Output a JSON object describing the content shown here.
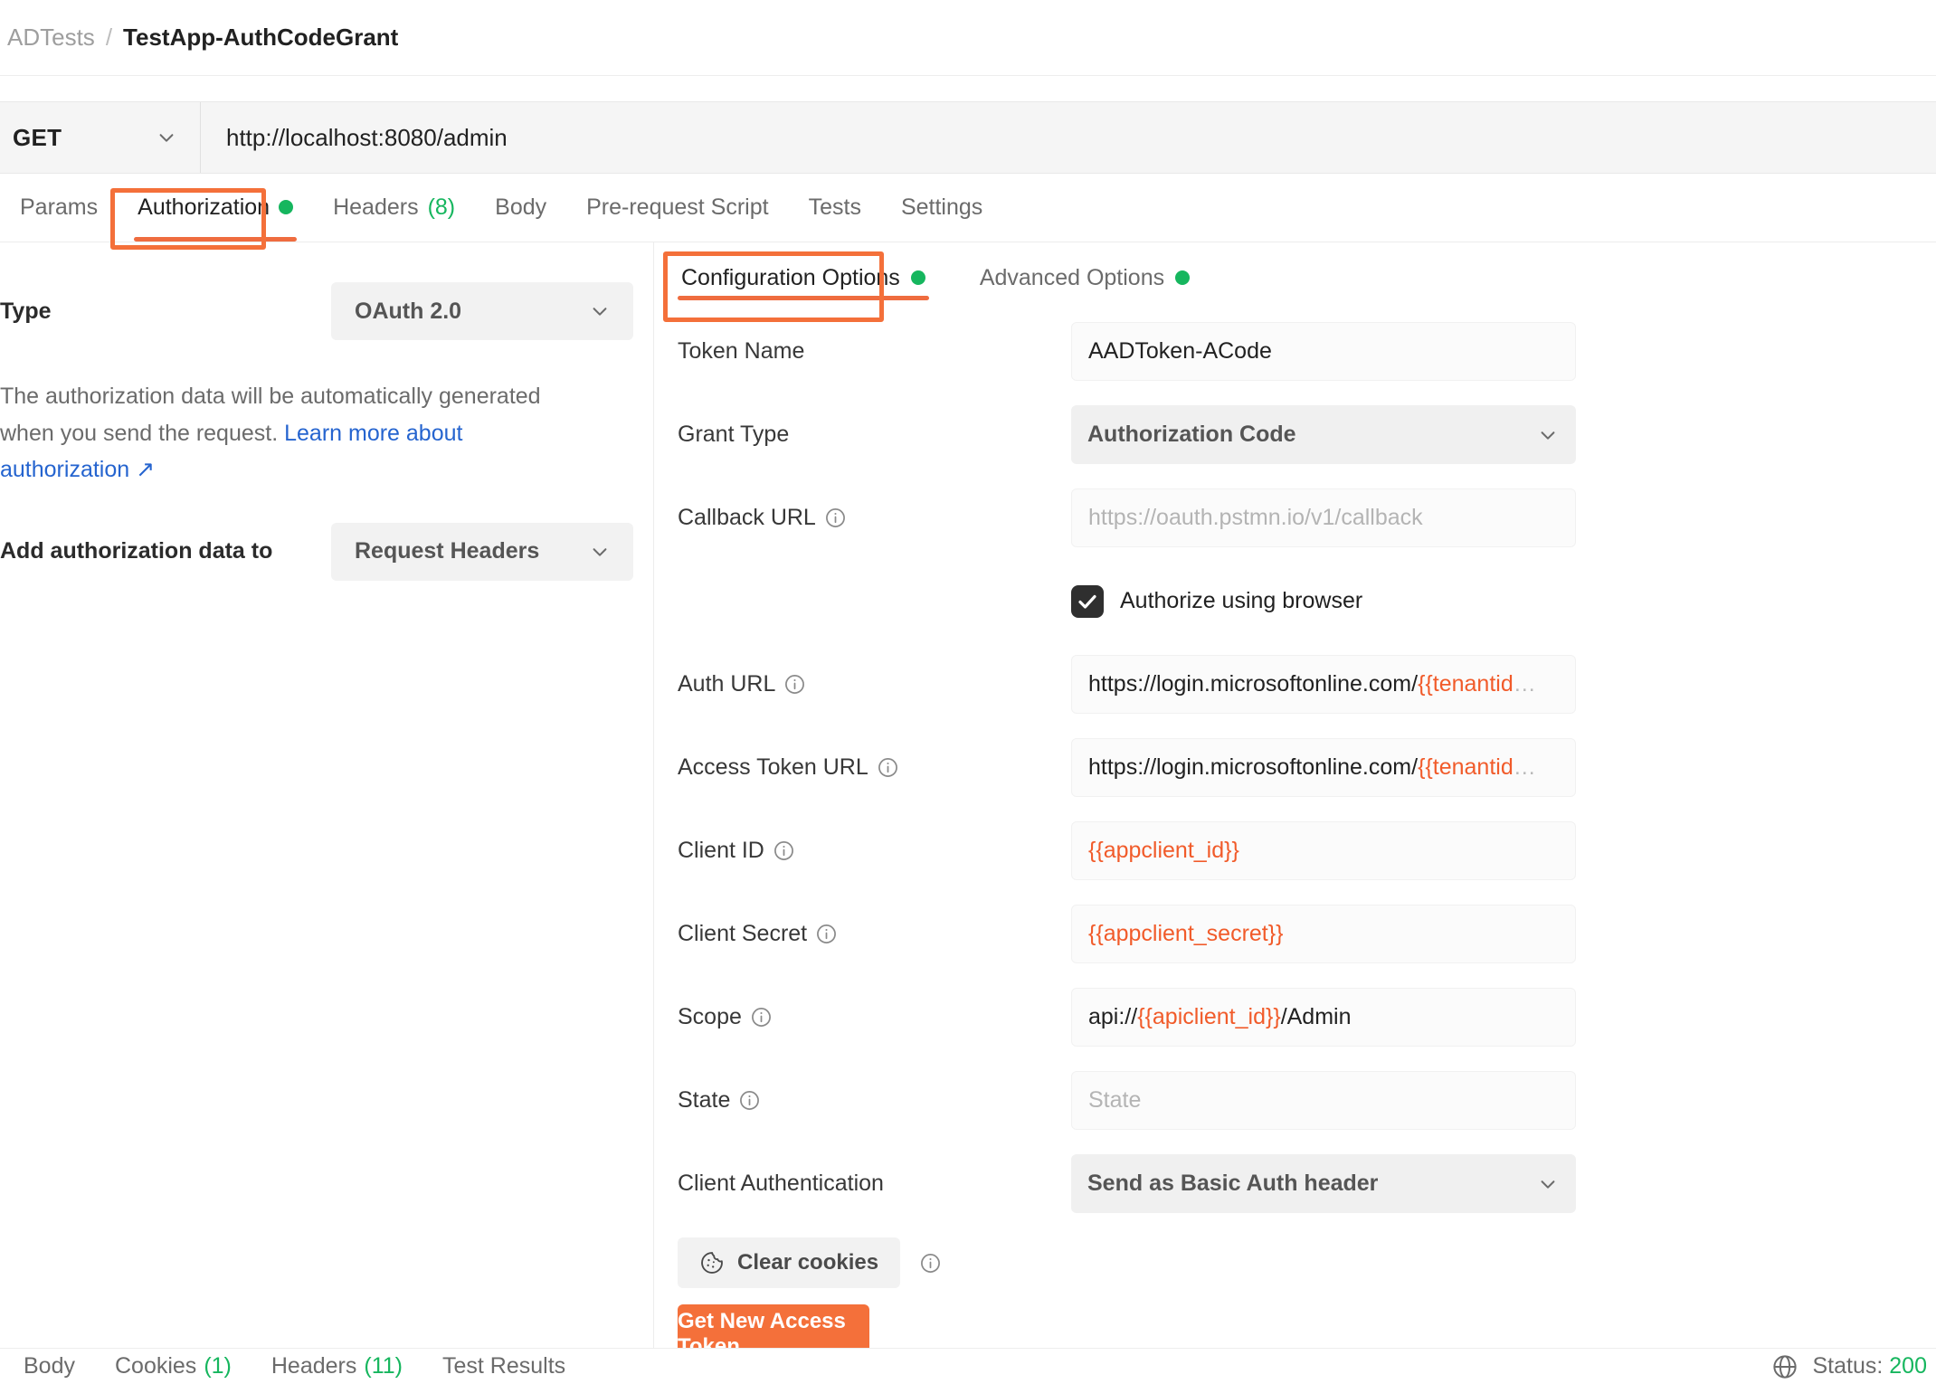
{
  "breadcrumb": {
    "collection": "ADTests",
    "separator": "/",
    "request": "TestApp-AuthCodeGrant"
  },
  "urlbar": {
    "method": "GET",
    "url": "http://localhost:8080/admin"
  },
  "request_tabs": [
    {
      "label": "Params",
      "active": false
    },
    {
      "label": "Authorization",
      "active": true,
      "dot": true
    },
    {
      "label": "Headers",
      "active": false,
      "count": "(8)"
    },
    {
      "label": "Body",
      "active": false
    },
    {
      "label": "Pre-request Script",
      "active": false
    },
    {
      "label": "Tests",
      "active": false
    },
    {
      "label": "Settings",
      "active": false
    }
  ],
  "auth_panel": {
    "type_label": "Type",
    "type_value": "OAuth 2.0",
    "description_1": "The authorization data will be automatically generated when you send the request. ",
    "description_link": "Learn more about authorization ↗",
    "add_to_label": "Add authorization data to",
    "add_to_value": "Request Headers"
  },
  "config_tabs": [
    {
      "label": "Configuration Options",
      "active": true,
      "dot": true
    },
    {
      "label": "Advanced Options",
      "active": false,
      "dot": true
    }
  ],
  "oauth_form": {
    "token_name": {
      "label": "Token Name",
      "value": "AADToken-ACode"
    },
    "grant_type": {
      "label": "Grant Type",
      "value": "Authorization Code"
    },
    "callback_url": {
      "label": "Callback URL",
      "placeholder": "https://oauth.pstmn.io/v1/callback",
      "value": ""
    },
    "authorize_using_browser": {
      "label": "Authorize using browser",
      "checked": true
    },
    "auth_url": {
      "label": "Auth URL",
      "value_static": "https://login.microsoftonline.com/",
      "value_var": "{{tenantid",
      "value_ellipsis": "…"
    },
    "access_token_url": {
      "label": "Access Token URL",
      "value_static": "https://login.microsoftonline.com/",
      "value_var": "{{tenantid",
      "value_ellipsis": "…"
    },
    "client_id": {
      "label": "Client ID",
      "value": "{{appclient_id}}"
    },
    "client_secret": {
      "label": "Client Secret",
      "value": "{{appclient_secret}}"
    },
    "scope": {
      "label": "Scope",
      "value_pre": "api://",
      "value_var": "{{apiclient_id}}",
      "value_post": "/Admin"
    },
    "state": {
      "label": "State",
      "placeholder": "State",
      "value": ""
    },
    "client_authentication": {
      "label": "Client Authentication",
      "value": "Send as Basic Auth header"
    }
  },
  "actions": {
    "clear_cookies": "Clear cookies",
    "get_new_access_token": "Get New Access Token"
  },
  "response_bar": {
    "tabs": [
      {
        "label": "Body",
        "count": ""
      },
      {
        "label": "Cookies",
        "count": "(1)"
      },
      {
        "label": "Headers",
        "count": "(11)"
      },
      {
        "label": "Test Results",
        "count": ""
      }
    ],
    "status_label": "Status:",
    "status_value": "200"
  },
  "colors": {
    "accent_orange": "#f4703a",
    "variable_orange": "#f15b2a",
    "green": "#16b65e",
    "link_blue": "#2564cf"
  }
}
